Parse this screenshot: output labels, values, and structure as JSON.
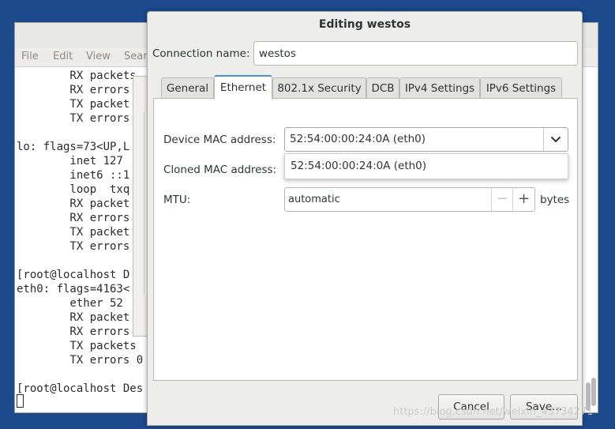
{
  "terminal": {
    "menu": [
      "File",
      "Edit",
      "View",
      "Sear"
    ],
    "lines": [
      "        RX packets",
      "        RX errors",
      "        TX packet",
      "        TX errors",
      "",
      "lo: flags=73<UP,L",
      "        inet 127",
      "        inet6 ::1",
      "        loop  txq",
      "        RX packet",
      "        RX errors",
      "        TX packet",
      "        TX errors",
      "",
      "[root@localhost D",
      "eth0: flags=4163<",
      "        ether 52",
      "        RX packet",
      "        RX errors",
      "        TX packets",
      "        TX errors 0",
      "",
      "[root@localhost Des"
    ]
  },
  "dialog": {
    "title": "Editing westos",
    "connection_name_label": "Connection name:",
    "connection_name_value": "westos",
    "tabs": [
      {
        "label": "General",
        "active": false
      },
      {
        "label": "Ethernet",
        "active": true
      },
      {
        "label": "802.1x Security",
        "active": false
      },
      {
        "label": "DCB",
        "active": false
      },
      {
        "label": "IPv4 Settings",
        "active": false
      },
      {
        "label": "IPv6 Settings",
        "active": false
      }
    ],
    "ethernet": {
      "device_mac_label": "Device MAC address:",
      "device_mac_value": "52:54:00:00:24:0A (eth0)",
      "dropdown_option": "52:54:00:00:24:0A (eth0)",
      "cloned_mac_label": "Cloned MAC address:",
      "mtu_label": "MTU:",
      "mtu_value": "automatic",
      "mtu_unit": "bytes",
      "minus_symbol": "−",
      "plus_symbol": "+"
    },
    "cancel_label": "Cancel",
    "save_label": "Save..."
  },
  "watermark": "https://blog.csdn.net/weixin_43734271",
  "colors": {
    "desktop": "#1c4a8c",
    "active_tab_accent": "#4a90d9"
  }
}
